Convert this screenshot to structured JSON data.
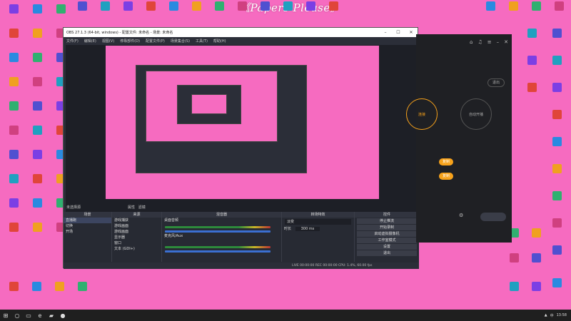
{
  "wallpaper_text": "《Papers Please》",
  "obs": {
    "title": "OBS 27.1.3 (64-bit, windows) - 配置文件: 未命名 - 场景: 未命名",
    "menu": [
      "文件(F)",
      "编辑(E)",
      "视图(V)",
      "停靠部件(D)",
      "配置文件(P)",
      "场景集合(S)",
      "工具(T)",
      "帮助(H)"
    ],
    "scene_label": "未选择源",
    "scene_tools": [
      "属性",
      "滤镜"
    ],
    "docks": {
      "scenes": {
        "title": "场景",
        "items": [
          "直播跑",
          "切换",
          "开场"
        ]
      },
      "sources": {
        "title": "来源",
        "items": [
          "游戏捕获",
          "游戏画面",
          "游戏画面",
          "显示器",
          "窗口",
          "文本 (GDI+)"
        ]
      },
      "mixer": {
        "title": "混音器",
        "channels": [
          "桌面音频",
          "麦克风/Aux"
        ]
      },
      "transitions": {
        "title": "转场特效",
        "type": "淡变",
        "duration_label": "时长",
        "duration": "300 ms"
      },
      "controls": {
        "title": "控件",
        "buttons": [
          "停止推流",
          "开始录制",
          "启动虚拟摄像机",
          "工作室模式",
          "设置",
          "退出"
        ]
      }
    },
    "status": "LIVE 00:00:00   REC 00:00:00   CPU: 1.4%, 60.00 fps"
  },
  "darkapp": {
    "exit_btn": "退出",
    "left_circle": "连接",
    "right_circle": "自动开播",
    "pill1": "复制",
    "pill2": "复制"
  },
  "taskbar": {
    "clock": "13:58",
    "lang": "中"
  }
}
